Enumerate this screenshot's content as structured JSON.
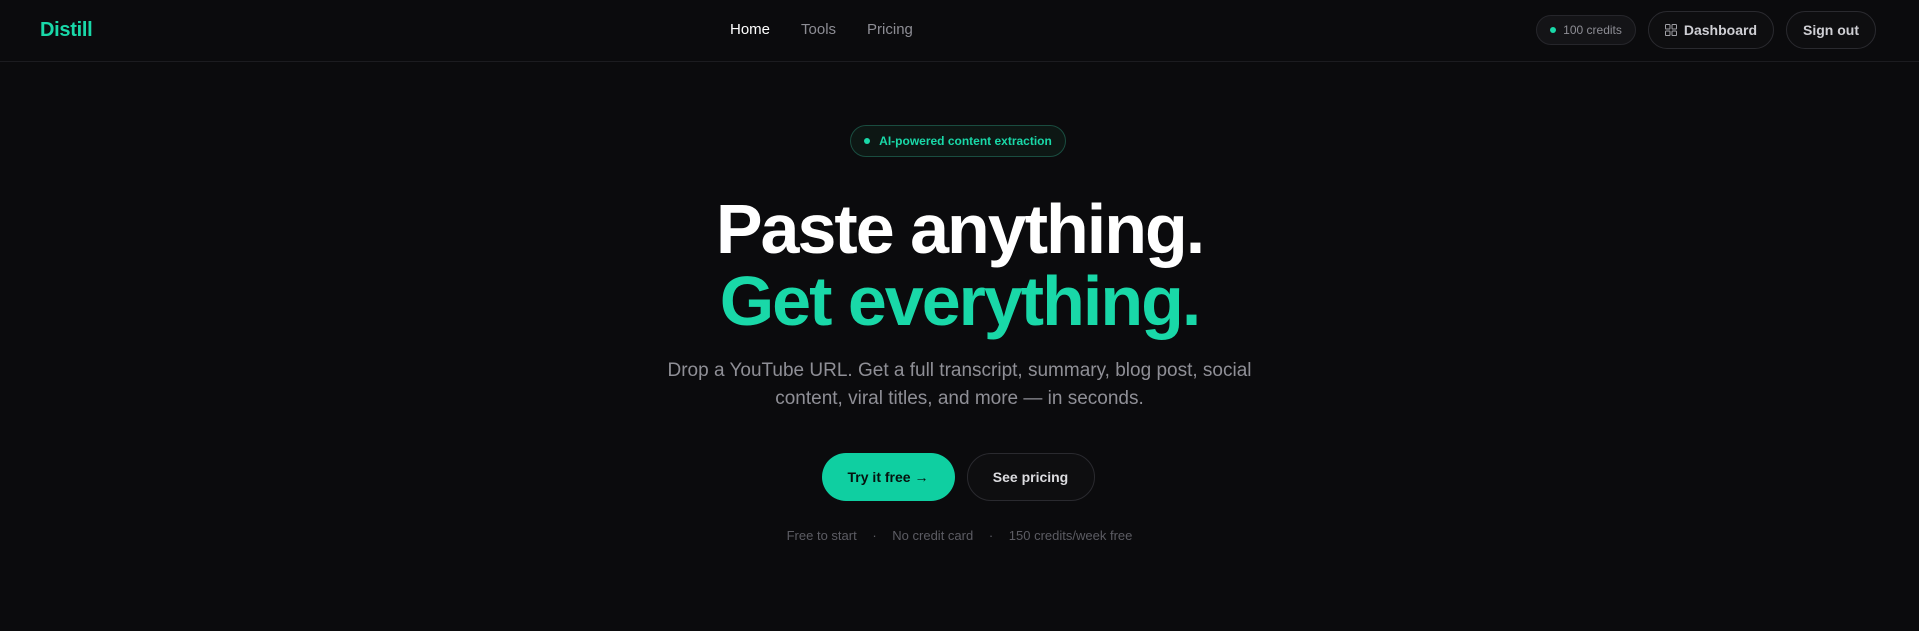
{
  "header": {
    "logo": "Distill",
    "nav": [
      {
        "label": "Home",
        "active": true
      },
      {
        "label": "Tools",
        "active": false
      },
      {
        "label": "Pricing",
        "active": false
      }
    ],
    "credits": "100 credits",
    "dashboard_label": "Dashboard",
    "signout_label": "Sign out"
  },
  "hero": {
    "badge": "AI-powered content extraction",
    "headline_line1": "Paste anything.",
    "headline_line2": "Get everything.",
    "subtext": "Drop a YouTube URL. Get a full transcript, summary, blog post, social content, viral titles, and more — in seconds.",
    "primary_cta": "Try it free →",
    "secondary_cta": "See pricing",
    "footnotes": [
      "Free to start",
      "No credit card",
      "150 credits/week free"
    ]
  },
  "colors": {
    "accent": "#19d8a8",
    "background": "#0b0b0d"
  }
}
